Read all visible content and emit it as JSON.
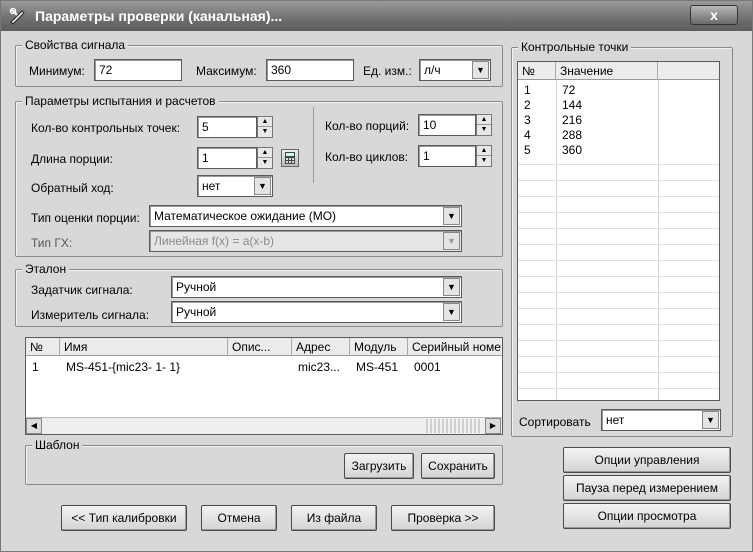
{
  "window": {
    "title": "Параметры проверки (канальная)...",
    "close_label": "x"
  },
  "signal_props": {
    "legend": "Свойства сигнала",
    "min_label": "Минимум:",
    "min_value": "72",
    "max_label": "Максимум:",
    "max_value": "360",
    "unit_label": "Ед. изм.:",
    "unit_value": "л/ч"
  },
  "test_params": {
    "legend": "Параметры испытания и расчетов",
    "points_label": "Кол-во контрольных точек:",
    "points_value": "5",
    "portion_len_label": "Длина порции:",
    "portion_len_value": "1",
    "reverse_label": "Обратный ход:",
    "reverse_value": "нет",
    "portions_label": "Кол-во порций:",
    "portions_value": "10",
    "cycles_label": "Кол-во циклов:",
    "cycles_value": "1",
    "estimate_label": "Тип оценки порции:",
    "estimate_value": "Математическое ожидание (МО)",
    "gx_label": "Тип ГХ:",
    "gx_value": "Линейная f(x) = a(x-b)"
  },
  "etalon": {
    "legend": "Эталон",
    "setter_label": "Задатчик сигнала:",
    "setter_value": "Ручной",
    "meter_label": "Измеритель сигнала:",
    "meter_value": "Ручной"
  },
  "devices": {
    "columns": [
      "№",
      "Имя",
      "Опис...",
      "Адрес",
      "Модуль",
      "Серийный номе"
    ],
    "rows": [
      {
        "num": "1",
        "name": "MS-451-{mic23- 1- 1}",
        "desc": "",
        "addr": "mic23...",
        "module": "MS-451",
        "serial": "0001"
      }
    ]
  },
  "template": {
    "legend": "Шаблон",
    "load_label": "Загрузить",
    "save_label": "Сохранить"
  },
  "control_points": {
    "legend": "Контрольные точки",
    "col_num": "№",
    "col_value": "Значение",
    "rows": [
      {
        "num": "1",
        "value": "72"
      },
      {
        "num": "2",
        "value": "144"
      },
      {
        "num": "3",
        "value": "216"
      },
      {
        "num": "4",
        "value": "288"
      },
      {
        "num": "5",
        "value": "360"
      }
    ],
    "sort_label": "Сортировать",
    "sort_value": "нет"
  },
  "side_buttons": {
    "control_options": "Опции управления",
    "pause_before": "Пауза перед измерением",
    "view_options": "Опции просмотра"
  },
  "bottom_buttons": {
    "calib_type": "<< Тип калибровки",
    "cancel": "Отмена",
    "from_file": "Из файла",
    "check": "Проверка >>"
  }
}
